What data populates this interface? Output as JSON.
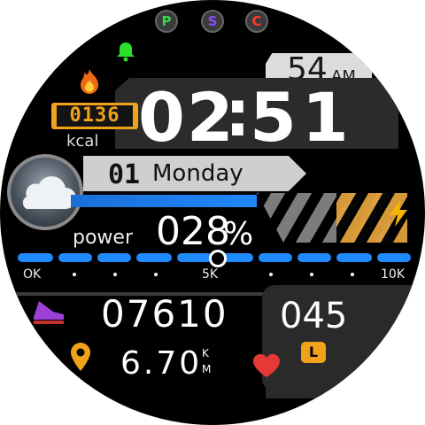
{
  "buttons": {
    "p": "P",
    "s": "S",
    "c": "C"
  },
  "colors": {
    "p": "#3bd14a",
    "s": "#8a4cff",
    "c": "#ff3b30",
    "accent": "#f0a21b",
    "blue": "#1f8bff",
    "heart": "#e53935"
  },
  "icons": {
    "alarm": "bell-icon",
    "calorie": "flame-icon",
    "weather": "cloud-icon",
    "steps": "shoe-icon",
    "location": "location-pin-icon",
    "heart": "heart-icon",
    "bolt": "lightning-icon"
  },
  "time": {
    "seconds": "54",
    "ampm": "AM",
    "hours": "02",
    "sep": ":",
    "minutes": "51"
  },
  "calories": {
    "value": "0136",
    "unit": "kcal"
  },
  "date": {
    "day": "01",
    "weekday": "Monday"
  },
  "power": {
    "label": "power",
    "value": "028",
    "unit": "%"
  },
  "scale": {
    "min": "OK",
    "mid": "5K",
    "max": "10K"
  },
  "steps": {
    "value": "07610"
  },
  "distance": {
    "value": "6.70",
    "unit_k": "K",
    "unit_m": "M"
  },
  "heart": {
    "value": "045",
    "badge": "L"
  }
}
